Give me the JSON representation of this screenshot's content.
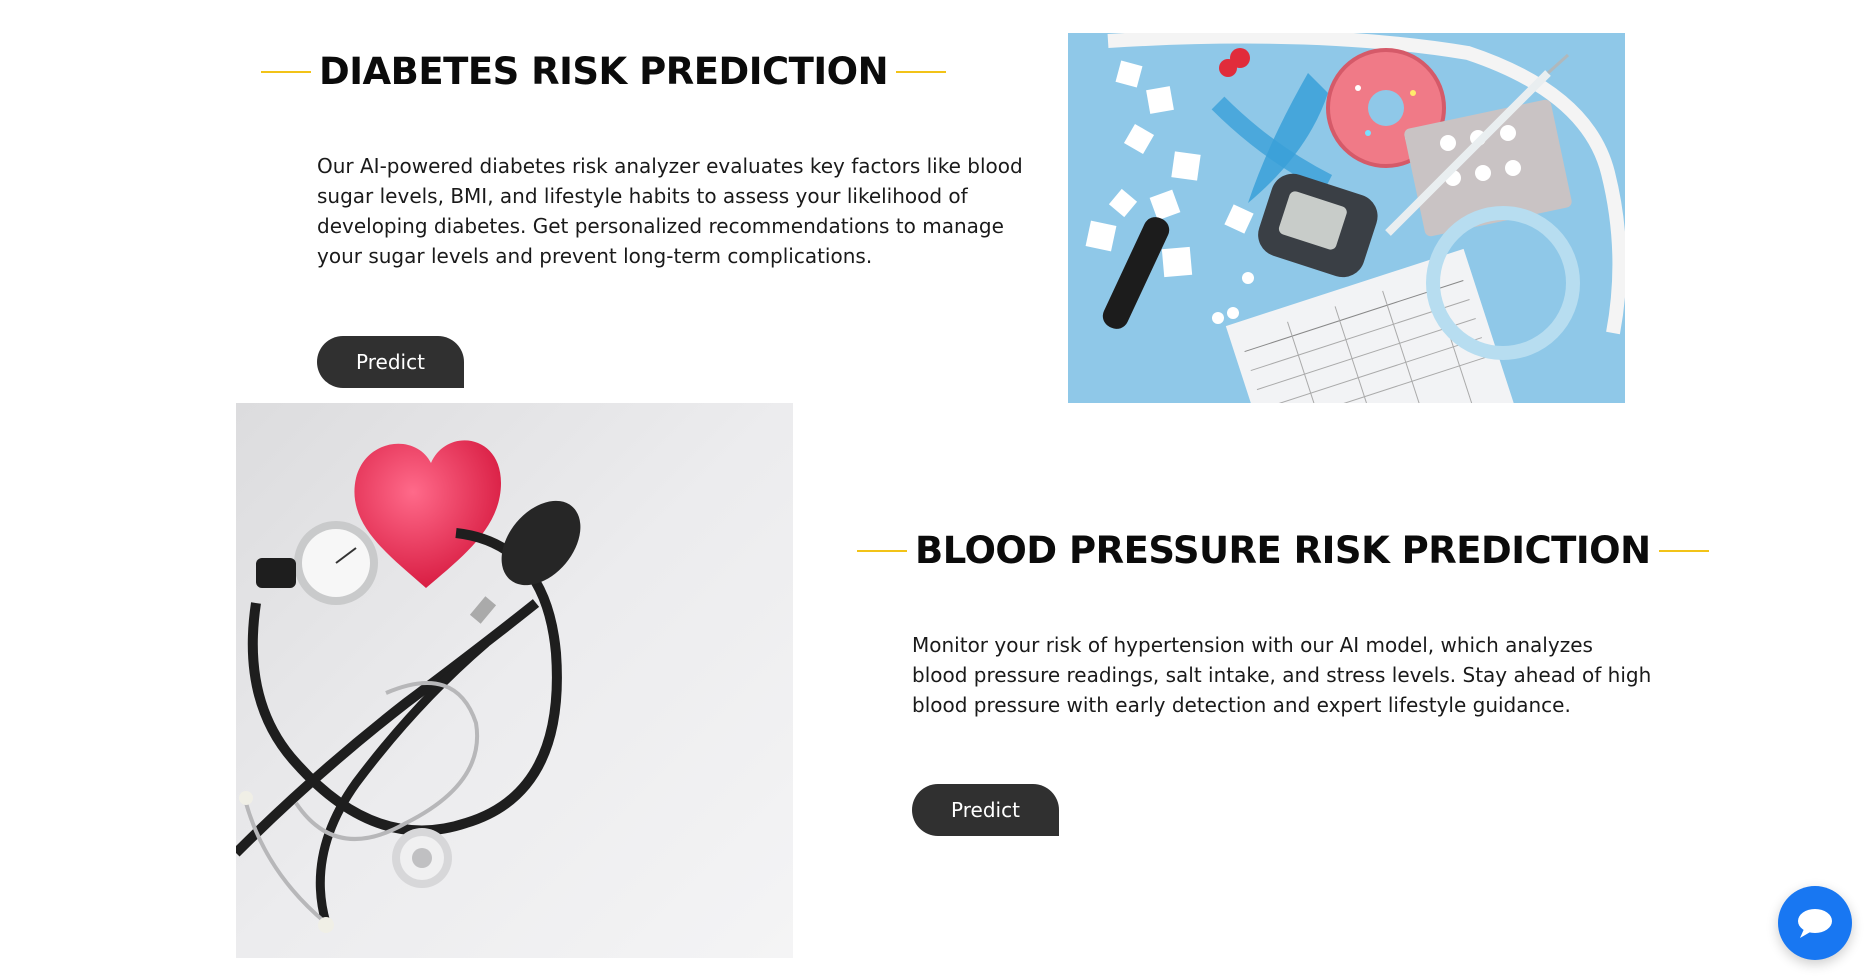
{
  "sections": [
    {
      "title": "DIABETES RISK PREDICTION",
      "description": "Our AI-powered diabetes risk analyzer evaluates key factors like blood sugar levels, BMI, and lifestyle habits to assess your likelihood of developing diabetes. Get personalized recommendations to manage your sugar levels and prevent long-term complications.",
      "button_label": "Predict",
      "image_icon": "diabetes-supplies-photo"
    },
    {
      "title": "BLOOD PRESSURE RISK PREDICTION",
      "description": "Monitor your risk of hypertension with our AI model, which analyzes blood pressure readings, salt intake, and stress levels. Stay ahead of high blood pressure with early detection and expert lifestyle guidance.",
      "button_label": "Predict",
      "image_icon": "blood-pressure-photo"
    }
  ],
  "chat_button": {
    "icon": "chat-bubble-icon"
  },
  "colors": {
    "accent_line": "#f2c318",
    "button_bg": "#303030",
    "chat_button": "#1877f2",
    "diabetes_photo_bg": "#8fc8e8",
    "bp_photo_bg": "#e9e9ea"
  }
}
